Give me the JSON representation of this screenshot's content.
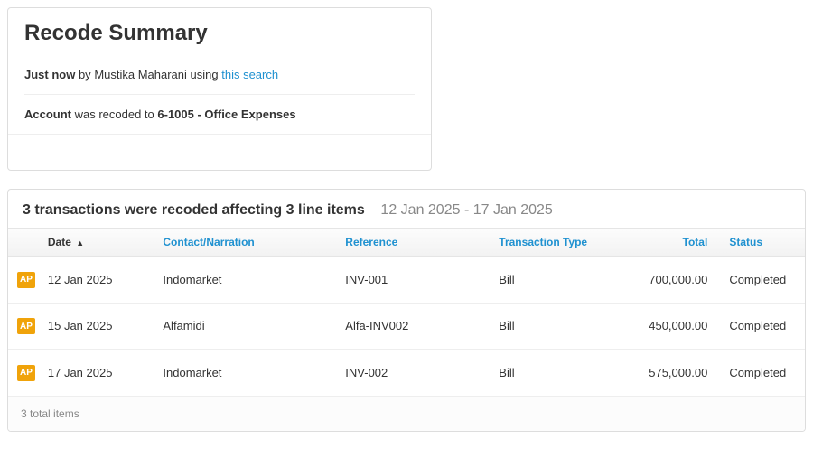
{
  "summary": {
    "title": "Recode Summary",
    "when": "Just now",
    "by_prefix": " by ",
    "user": "Mustika Maharani",
    "using_text": " using ",
    "search_link": "this search",
    "account_label": "Account",
    "recoded_mid": " was recoded to ",
    "recoded_to": "6-1005 - Office Expenses"
  },
  "table": {
    "count_text": "3 transactions were recoded affecting 3 line items",
    "date_range": "12 Jan 2025 - 17 Jan 2025",
    "headers": {
      "date": "Date",
      "contact": "Contact/Narration",
      "reference": "Reference",
      "type": "Transaction Type",
      "total": "Total",
      "status": "Status"
    },
    "badge": "AP",
    "rows": [
      {
        "date": "12 Jan 2025",
        "contact": "Indomarket",
        "reference": "INV-001",
        "type": "Bill",
        "total": "700,000.00",
        "status": "Completed"
      },
      {
        "date": "15 Jan 2025",
        "contact": "Alfamidi",
        "reference": "Alfa-INV002",
        "type": "Bill",
        "total": "450,000.00",
        "status": "Completed"
      },
      {
        "date": "17 Jan 2025",
        "contact": "Indomarket",
        "reference": "INV-002",
        "type": "Bill",
        "total": "575,000.00",
        "status": "Completed"
      }
    ],
    "footer": "3 total items"
  }
}
